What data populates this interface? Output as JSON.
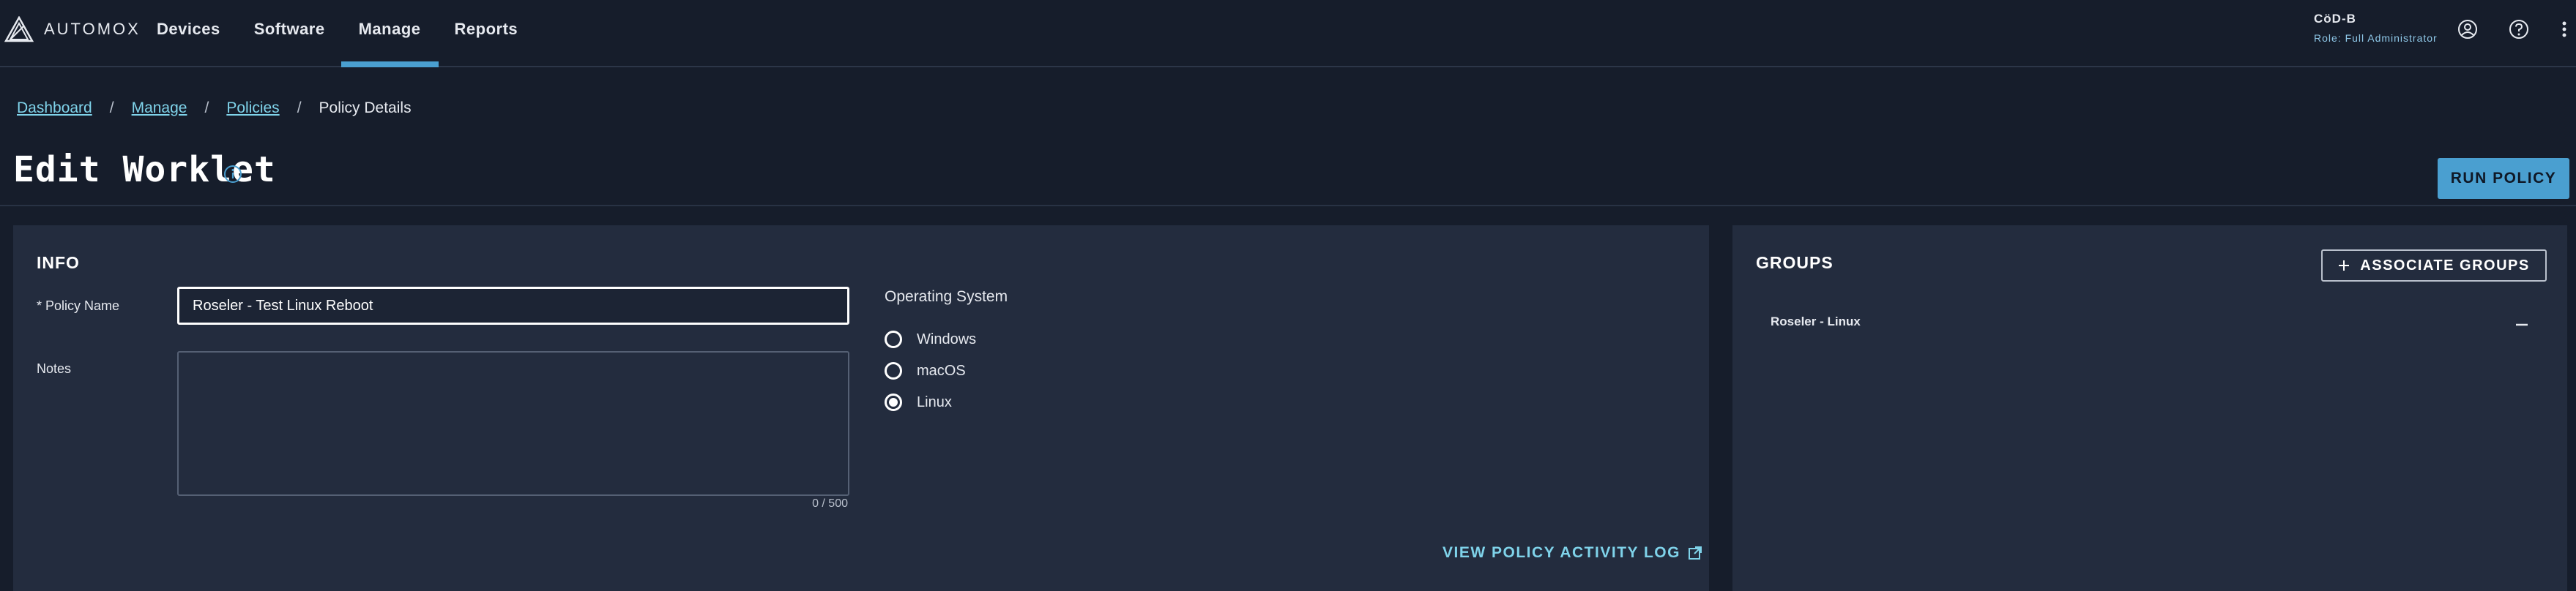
{
  "app": {
    "brand": "AUTOMOX"
  },
  "nav": {
    "items": [
      {
        "label": "Devices",
        "active": false
      },
      {
        "label": "Software",
        "active": false
      },
      {
        "label": "Manage",
        "active": true
      },
      {
        "label": "Reports",
        "active": false
      }
    ]
  },
  "user": {
    "name": "CöD-B",
    "role": "Role: Full Administrator"
  },
  "breadcrumb": {
    "items": [
      "Dashboard",
      "Manage",
      "Policies"
    ],
    "separator": "/",
    "current": "Policy Details"
  },
  "page": {
    "title": "Edit Worklet",
    "run_label": "RUN POLICY"
  },
  "info": {
    "title": "INFO",
    "policy_name_label": "* Policy Name",
    "policy_name_value": "Roseler - Test Linux Reboot",
    "notes_label": "Notes",
    "notes_value": "",
    "notes_counter": "0 / 500",
    "os_title": "Operating System",
    "os_options": [
      {
        "label": "Windows",
        "selected": false
      },
      {
        "label": "macOS",
        "selected": false
      },
      {
        "label": "Linux",
        "selected": true
      }
    ],
    "activity_link": "VIEW POLICY ACTIVITY LOG"
  },
  "groups": {
    "title": "GROUPS",
    "associate_label": "ASSOCIATE GROUPS",
    "items": [
      {
        "name": "Roseler - Linux"
      }
    ]
  },
  "colors": {
    "background": "#161d2b",
    "panel": "#232c3e",
    "accent": "#4a9fd0",
    "link": "#7fd3ea"
  },
  "icons": {
    "logo": "automox-logo-icon",
    "account": "account-icon",
    "help": "help-icon",
    "more": "more-vertical-icon",
    "info": "info-icon",
    "external": "external-link-icon",
    "plus": "plus-icon",
    "remove": "minus-icon"
  }
}
